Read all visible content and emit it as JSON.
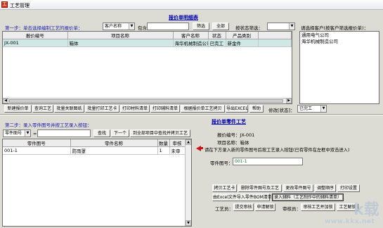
{
  "window": {
    "title": "工艺管理",
    "icon": "app-icon"
  },
  "top": {
    "section_title": "报价单明细表",
    "step1": "第一步：单击选择编制工艺的报价单：",
    "filter_field": "客户名称",
    "filter_op": "包含",
    "filter_value": "",
    "filter_btn": "筛选",
    "all_btn": "全部",
    "status_filter_label": "按状态筛选：",
    "status_filter_value": "",
    "customer_hint": "请选择客户(按客户筛选报价单)：",
    "columns": [
      "报价编号",
      "项目名称",
      "客户名称",
      "状态",
      "产品类别"
    ],
    "rows": [
      [
        "JX-001",
        "箱体",
        "海华机械制造公司",
        "已完工",
        "新金件"
      ]
    ],
    "customers": [
      "通用电气公司",
      "海华机械制造公司"
    ],
    "toolbar": [
      "新建报价单",
      "查询工艺",
      "批量关联图纸",
      "批量打印工艺卡",
      "打印材料清单",
      "打印辅料清单",
      "根据报价单工艺拷贝",
      "导出EXCEL",
      "帮助"
    ],
    "status_change_label": "修改[状态]：",
    "status_change_value": "已完工"
  },
  "bottom": {
    "section_title": "报价单零件工艺",
    "step2": "第二步：录入零件图号并按工艺录入按钮：",
    "search_field": "零件图号",
    "search_op": "=",
    "search_value": "",
    "find_btn": "查找",
    "next_btn": "下一个",
    "search_all_btn": "到全部项目中查找并拷贝工艺",
    "columns": [
      "零件图号",
      "零件名称",
      "数量",
      "审核"
    ],
    "rows": [
      [
        "001-1",
        "防雨罩",
        "1",
        "未审"
      ]
    ],
    "quote_no_label": "报价编号：",
    "quote_no": "JX-001",
    "project_label": "项目名称：",
    "project": "箱体",
    "instruction": "请在下方录入新的零件图号后按工艺录入按钮(已有零件在左框中双击进入)",
    "part_no_label": "零件图号：",
    "part_no": "001-1",
    "actions_row1": [
      "拷贝工艺卡",
      "删除零件图号及工艺",
      "更改零件图号",
      "调整顺序",
      "打印设置"
    ],
    "import_btn": "由Excel文件导入零件BOM清单",
    "materials_btn": "录入辅料（工艺制作中的辅料清单）",
    "craftsman_label": "工艺员：",
    "submit_audit_btn": "提交审核",
    "request_unlock_btn": "申请解锁",
    "auditor_label": "审核员：",
    "audit_lock_btn": "审核工艺并加锁",
    "unlock_btn": "工艺解锁"
  },
  "watermark": {
    "text": "www.kkx.net",
    "logo": "k载"
  },
  "colors": {
    "selected_row": "#cfe8e6",
    "section_title": "#0000b8",
    "step_label": "#1a1ab0",
    "arrow": "#d31010",
    "panel": "#dcdcd5"
  }
}
